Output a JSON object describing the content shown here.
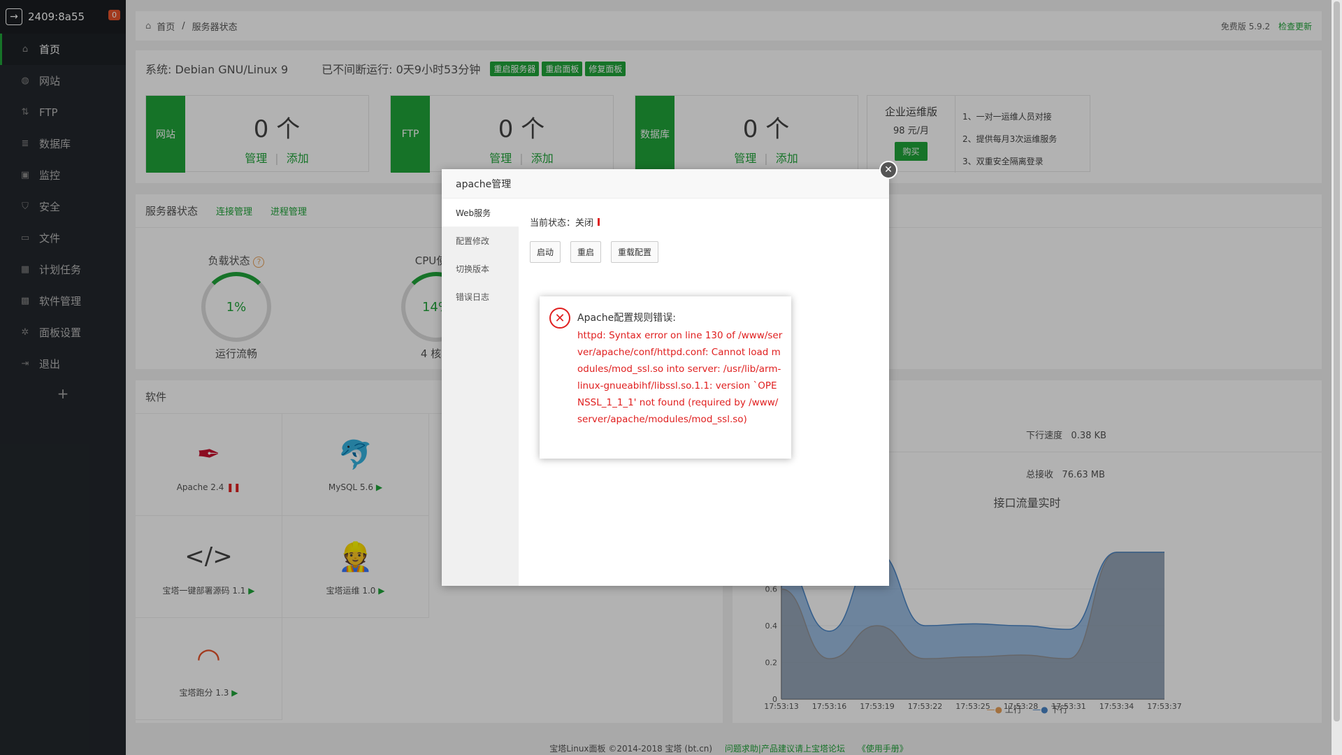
{
  "sidebar": {
    "host": "2409:8a55",
    "badge": "0",
    "items": [
      {
        "label": "首页",
        "icon": "home-icon"
      },
      {
        "label": "网站",
        "icon": "globe-icon"
      },
      {
        "label": "FTP",
        "icon": "ftp-icon"
      },
      {
        "label": "数据库",
        "icon": "database-icon"
      },
      {
        "label": "监控",
        "icon": "monitor-icon"
      },
      {
        "label": "安全",
        "icon": "shield-icon"
      },
      {
        "label": "文件",
        "icon": "folder-icon"
      },
      {
        "label": "计划任务",
        "icon": "calendar-icon"
      },
      {
        "label": "软件管理",
        "icon": "grid-icon"
      },
      {
        "label": "面板设置",
        "icon": "gear-icon"
      },
      {
        "label": "退出",
        "icon": "logout-icon"
      }
    ],
    "plus": "+"
  },
  "breadcrumb": {
    "home": "首页",
    "sep": "/",
    "current": "服务器状态",
    "version": "免费版 5.9.2",
    "update": "检查更新"
  },
  "system": {
    "os": "系统: Debian GNU/Linux 9",
    "uptime": "已不间断运行: 0天9小时53分钟",
    "buttons": [
      "重启服务器",
      "重启面板",
      "修复面板"
    ]
  },
  "cards": [
    {
      "label": "网站",
      "count": "0 个",
      "manage": "管理",
      "sep": "|",
      "add": "添加"
    },
    {
      "label": "FTP",
      "count": "0 个",
      "manage": "管理",
      "sep": "|",
      "add": "添加"
    },
    {
      "label": "数据库",
      "count": "0 个",
      "manage": "管理",
      "sep": "|",
      "add": "添加"
    }
  ],
  "enterprise": {
    "title": "企业运维版",
    "price": "98 元/月",
    "buy": "购买",
    "features": [
      "1、一对一运维人员对接",
      "2、提供每月3次运维服务",
      "3、双重安全隔离登录"
    ]
  },
  "server_status": {
    "title": "服务器状态",
    "links": [
      "连接管理",
      "进程管理"
    ],
    "gauges": [
      {
        "title": "负载状态",
        "value": "1%",
        "sub": "运行流畅"
      },
      {
        "title": "CPU使用",
        "value": "14%",
        "sub": "4 核心"
      }
    ]
  },
  "software": {
    "title": "软件",
    "items": [
      {
        "label": "Apache 2.4",
        "icon": "feather-icon"
      },
      {
        "label": "MySQL 5.6",
        "icon": "dolphin-icon"
      },
      {
        "label": "宝塔一键部署源码 1.1",
        "icon": "code-icon"
      },
      {
        "label": "宝塔运维 1.0",
        "icon": "operator-icon"
      },
      {
        "label": "宝塔跑分 1.3",
        "icon": "speedometer-icon"
      }
    ]
  },
  "network": {
    "down_speed_label": "下行速度",
    "down_speed": "0.38 KB",
    "total_recv_label": "总接收",
    "total_recv": "76.63 MB",
    "chart_title": "接口流量实时",
    "legend": [
      "上行",
      "下行"
    ]
  },
  "chart_data": {
    "type": "area",
    "title": "接口流量实时",
    "x": [
      "17:53:13",
      "17:53:16",
      "17:53:19",
      "17:53:22",
      "17:53:25",
      "17:53:28",
      "17:53:31",
      "17:53:34",
      "17:53:37"
    ],
    "ylim": [
      0,
      0.8
    ],
    "yticks": [
      "0",
      "0.2",
      "0.4",
      "0.6"
    ],
    "series": [
      {
        "name": "上行",
        "color": "#e8a15a",
        "values": [
          0.6,
          0.22,
          0.4,
          0.22,
          0.23,
          0.24,
          0.22,
          0.85,
          1.0
        ]
      },
      {
        "name": "下行",
        "color": "#4a86c8",
        "values": [
          0.75,
          0.37,
          0.9,
          0.4,
          0.41,
          0.4,
          0.38,
          0.85,
          0.8
        ]
      }
    ]
  },
  "modal": {
    "title": "apache管理",
    "tabs": [
      "Web服务",
      "配置修改",
      "切换版本",
      "错误日志"
    ],
    "status_label": "当前状态：关闭",
    "buttons": [
      "启动",
      "重启",
      "重载配置"
    ]
  },
  "error": {
    "title": "Apache配置规则错误:",
    "message": "httpd: Syntax error on line 130 of /www/server/apache/conf/httpd.conf: Cannot load modules/mod_ssl.so into server: /usr/lib/arm-linux-gnueabihf/libssl.so.1.1: version `OPENSSL_1_1_1' not found (required by /www/server/apache/modules/mod_ssl.so)"
  },
  "footer": {
    "copyright": "宝塔Linux面板 ©2014-2018 宝塔 (bt.cn)",
    "forum": "问题求助|产品建议请上宝塔论坛",
    "manual": "《使用手册》"
  }
}
